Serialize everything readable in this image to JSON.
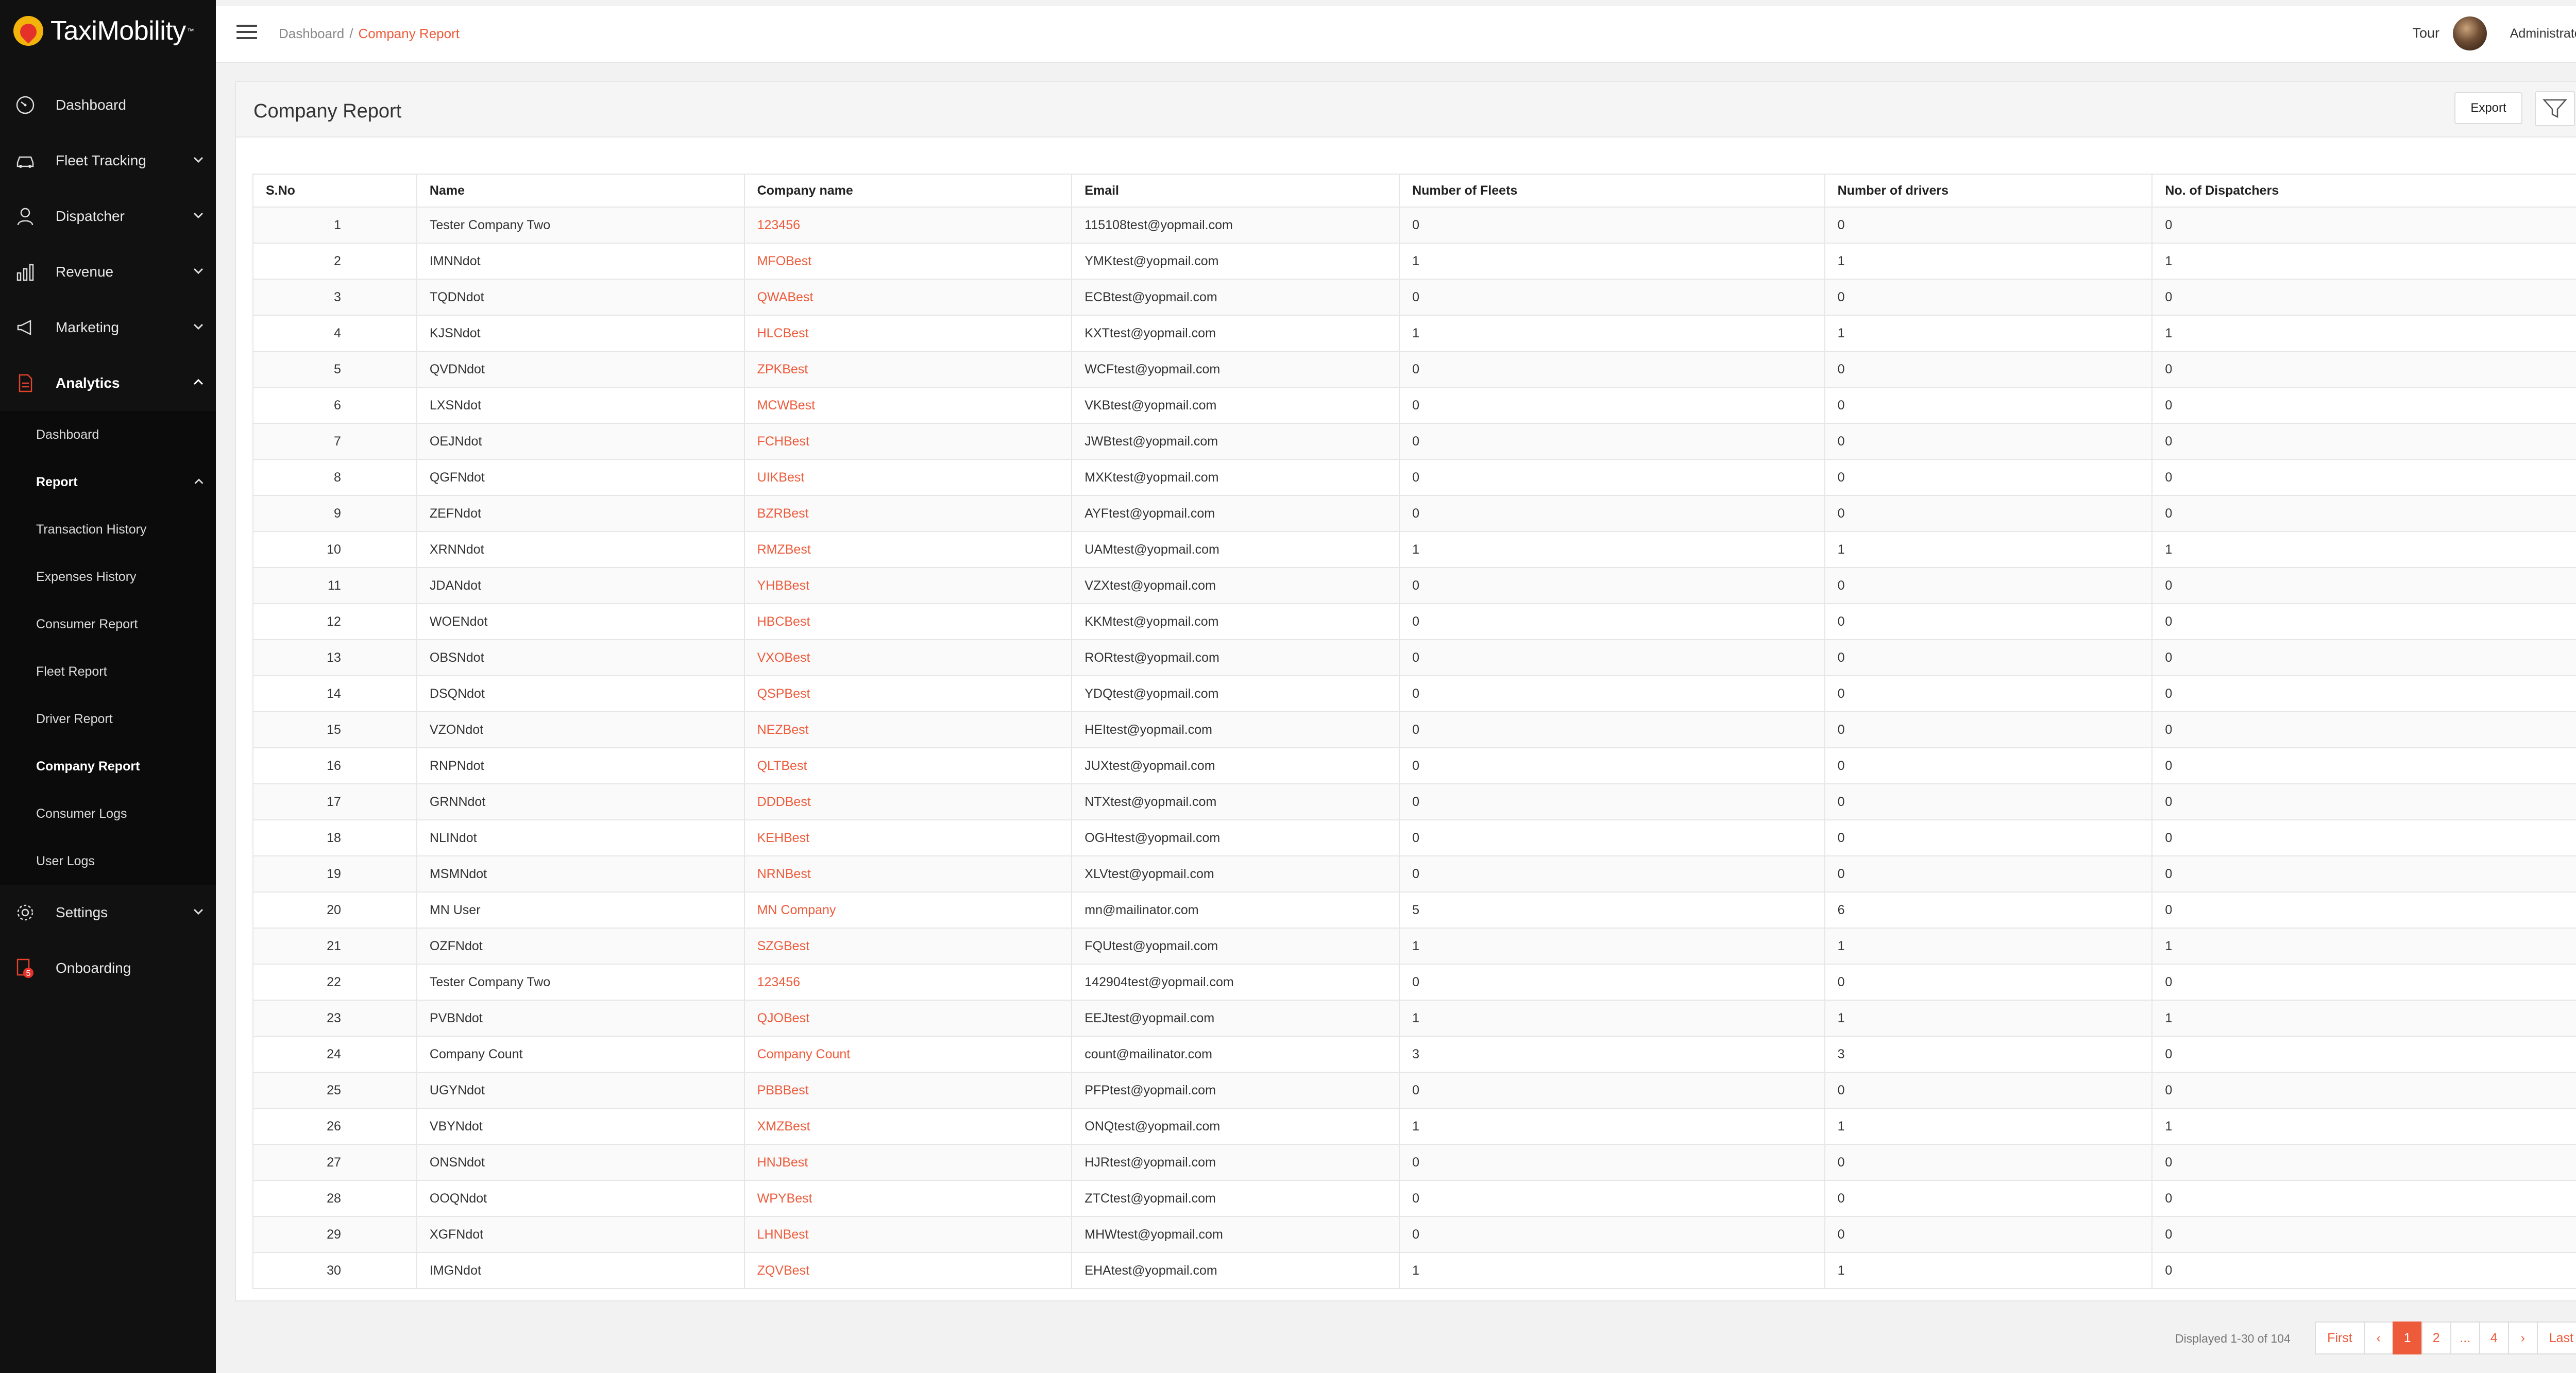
{
  "app": {
    "name": "TaxiMobility",
    "tm": "™"
  },
  "sidebar": {
    "items": [
      {
        "label": "Dashboard",
        "icon": "speedometer-icon"
      },
      {
        "label": "Fleet Tracking",
        "icon": "car-icon"
      },
      {
        "label": "Dispatcher",
        "icon": "dispatcher-icon"
      },
      {
        "label": "Revenue",
        "icon": "bar-chart-icon"
      },
      {
        "label": "Marketing",
        "icon": "megaphone-icon"
      },
      {
        "label": "Analytics",
        "icon": "document-icon"
      }
    ],
    "analytics_sub": [
      {
        "label": "Dashboard"
      },
      {
        "label": "Report"
      }
    ],
    "report_sub": [
      {
        "label": "Transaction History"
      },
      {
        "label": "Expenses History"
      },
      {
        "label": "Consumer Report"
      },
      {
        "label": "Fleet Report"
      },
      {
        "label": "Driver Report"
      },
      {
        "label": "Company Report"
      },
      {
        "label": "Consumer Logs"
      },
      {
        "label": "User Logs"
      }
    ],
    "bottom_items": [
      {
        "label": "Settings",
        "icon": "gear-icon"
      },
      {
        "label": "Onboarding",
        "icon": "onboarding-icon",
        "badge": "5"
      }
    ]
  },
  "header": {
    "breadcrumb": {
      "root": "Dashboard",
      "sep": "/",
      "current": "Company Report"
    },
    "tour": "Tour",
    "user": "Administrator"
  },
  "panel": {
    "title": "Company Report",
    "export_label": "Export"
  },
  "table": {
    "headers": [
      "S.No",
      "Name",
      "Company name",
      "Email",
      "Number of Fleets",
      "Number of drivers",
      "No. of Dispatchers"
    ],
    "rows": [
      [
        "1",
        "Tester Company Two",
        "123456",
        "115108test@yopmail.com",
        "0",
        "0",
        "0"
      ],
      [
        "2",
        "IMNNdot",
        "MFOBest",
        "YMKtest@yopmail.com",
        "1",
        "1",
        "1"
      ],
      [
        "3",
        "TQDNdot",
        "QWABest",
        "ECBtest@yopmail.com",
        "0",
        "0",
        "0"
      ],
      [
        "4",
        "KJSNdot",
        "HLCBest",
        "KXTtest@yopmail.com",
        "1",
        "1",
        "1"
      ],
      [
        "5",
        "QVDNdot",
        "ZPKBest",
        "WCFtest@yopmail.com",
        "0",
        "0",
        "0"
      ],
      [
        "6",
        "LXSNdot",
        "MCWBest",
        "VKBtest@yopmail.com",
        "0",
        "0",
        "0"
      ],
      [
        "7",
        "OEJNdot",
        "FCHBest",
        "JWBtest@yopmail.com",
        "0",
        "0",
        "0"
      ],
      [
        "8",
        "QGFNdot",
        "UIKBest",
        "MXKtest@yopmail.com",
        "0",
        "0",
        "0"
      ],
      [
        "9",
        "ZEFNdot",
        "BZRBest",
        "AYFtest@yopmail.com",
        "0",
        "0",
        "0"
      ],
      [
        "10",
        "XRNNdot",
        "RMZBest",
        "UAMtest@yopmail.com",
        "1",
        "1",
        "1"
      ],
      [
        "11",
        "JDANdot",
        "YHBBest",
        "VZXtest@yopmail.com",
        "0",
        "0",
        "0"
      ],
      [
        "12",
        "WOENdot",
        "HBCBest",
        "KKMtest@yopmail.com",
        "0",
        "0",
        "0"
      ],
      [
        "13",
        "OBSNdot",
        "VXOBest",
        "RORtest@yopmail.com",
        "0",
        "0",
        "0"
      ],
      [
        "14",
        "DSQNdot",
        "QSPBest",
        "YDQtest@yopmail.com",
        "0",
        "0",
        "0"
      ],
      [
        "15",
        "VZONdot",
        "NEZBest",
        "HEItest@yopmail.com",
        "0",
        "0",
        "0"
      ],
      [
        "16",
        "RNPNdot",
        "QLTBest",
        "JUXtest@yopmail.com",
        "0",
        "0",
        "0"
      ],
      [
        "17",
        "GRNNdot",
        "DDDBest",
        "NTXtest@yopmail.com",
        "0",
        "0",
        "0"
      ],
      [
        "18",
        "NLINdot",
        "KEHBest",
        "OGHtest@yopmail.com",
        "0",
        "0",
        "0"
      ],
      [
        "19",
        "MSMNdot",
        "NRNBest",
        "XLVtest@yopmail.com",
        "0",
        "0",
        "0"
      ],
      [
        "20",
        "MN User",
        "MN Company",
        "mn@mailinator.com",
        "5",
        "6",
        "0"
      ],
      [
        "21",
        "OZFNdot",
        "SZGBest",
        "FQUtest@yopmail.com",
        "1",
        "1",
        "1"
      ],
      [
        "22",
        "Tester Company Two",
        "123456",
        "142904test@yopmail.com",
        "0",
        "0",
        "0"
      ],
      [
        "23",
        "PVBNdot",
        "QJOBest",
        "EEJtest@yopmail.com",
        "1",
        "1",
        "1"
      ],
      [
        "24",
        "Company Count",
        "Company Count",
        "count@mailinator.com",
        "3",
        "3",
        "0"
      ],
      [
        "25",
        "UGYNdot",
        "PBBBest",
        "PFPtest@yopmail.com",
        "0",
        "0",
        "0"
      ],
      [
        "26",
        "VBYNdot",
        "XMZBest",
        "ONQtest@yopmail.com",
        "1",
        "1",
        "1"
      ],
      [
        "27",
        "ONSNdot",
        "HNJBest",
        "HJRtest@yopmail.com",
        "0",
        "0",
        "0"
      ],
      [
        "28",
        "OOQNdot",
        "WPYBest",
        "ZTCtest@yopmail.com",
        "0",
        "0",
        "0"
      ],
      [
        "29",
        "XGFNdot",
        "LHNBest",
        "MHWtest@yopmail.com",
        "0",
        "0",
        "0"
      ],
      [
        "30",
        "IMGNdot",
        "ZQVBest",
        "EHAtest@yopmail.com",
        "1",
        "1",
        "0"
      ]
    ]
  },
  "footer": {
    "displayed": "Displayed 1-30 of 104",
    "pager": [
      "First",
      "‹",
      "1",
      "2",
      "...",
      "4",
      "›",
      "Last"
    ],
    "active_page": "1"
  },
  "colors": {
    "accent": "#ee5b3b",
    "sidebar_bg": "#111111"
  }
}
